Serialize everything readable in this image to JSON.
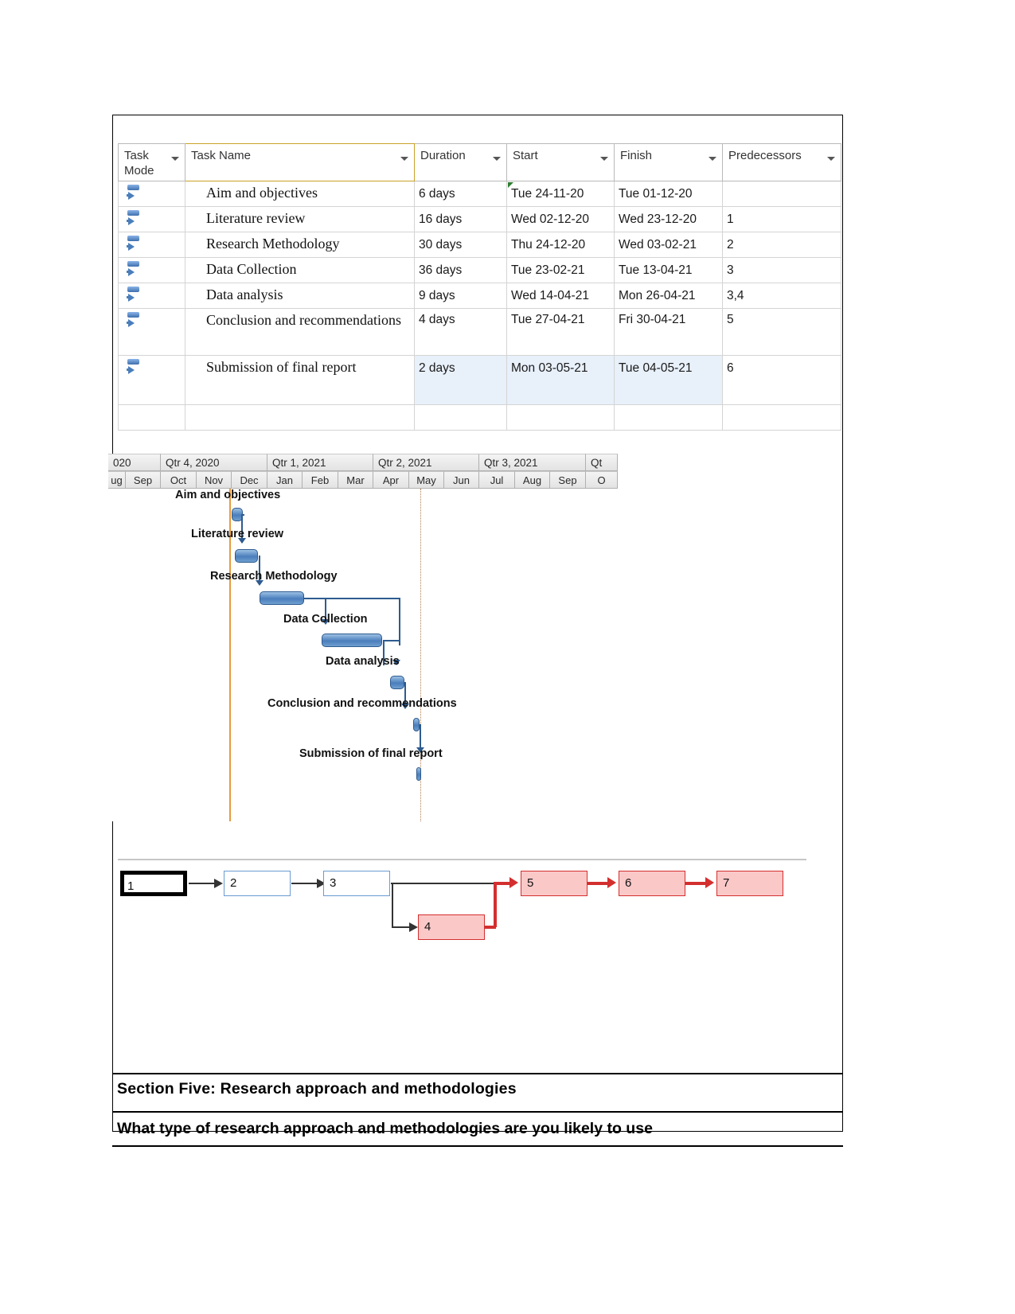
{
  "project_grid": {
    "columns": [
      {
        "label": "Task\nMode",
        "key": "mode"
      },
      {
        "label": "Task Name",
        "key": "name"
      },
      {
        "label": "Duration",
        "key": "duration"
      },
      {
        "label": "Start",
        "key": "start"
      },
      {
        "label": "Finish",
        "key": "finish"
      },
      {
        "label": "Predecessors",
        "key": "predecessors"
      }
    ],
    "rows": [
      {
        "id": 1,
        "mode_icon": "auto-schedule-icon",
        "name": "Aim and objectives",
        "duration": "6 days",
        "start": "Tue 24-11-20",
        "finish": "Tue 01-12-20",
        "predecessors": ""
      },
      {
        "id": 2,
        "mode_icon": "auto-schedule-icon",
        "name": "Literature review",
        "duration": "16 days",
        "start": "Wed 02-12-20",
        "finish": "Wed 23-12-20",
        "predecessors": "1"
      },
      {
        "id": 3,
        "mode_icon": "auto-schedule-icon",
        "name": "Research Methodology",
        "duration": "30 days",
        "start": "Thu 24-12-20",
        "finish": "Wed 03-02-21",
        "predecessors": "2"
      },
      {
        "id": 4,
        "mode_icon": "auto-schedule-icon",
        "name": "Data Collection",
        "duration": "36 days",
        "start": "Tue 23-02-21",
        "finish": "Tue 13-04-21",
        "predecessors": "3"
      },
      {
        "id": 5,
        "mode_icon": "auto-schedule-icon",
        "name": "Data analysis",
        "duration": "9 days",
        "start": "Wed 14-04-21",
        "finish": "Mon 26-04-21",
        "predecessors": "3,4"
      },
      {
        "id": 6,
        "mode_icon": "auto-schedule-icon",
        "name": "Conclusion and recommendations",
        "duration": "4 days",
        "start": "Tue 27-04-21",
        "finish": "Fri 30-04-21",
        "predecessors": "5"
      },
      {
        "id": 7,
        "mode_icon": "auto-schedule-icon",
        "name": "Submission of final report",
        "duration": "2 days",
        "start": "Mon 03-05-21",
        "finish": "Tue 04-05-21",
        "predecessors": "6"
      }
    ]
  },
  "gantt": {
    "quarters": [
      "020",
      "Qtr 4, 2020",
      "Qtr 1, 2021",
      "Qtr 2, 2021",
      "Qtr 3, 2021",
      "Qt"
    ],
    "months": [
      "ug",
      "Sep",
      "Oct",
      "Nov",
      "Dec",
      "Jan",
      "Feb",
      "Mar",
      "Apr",
      "May",
      "Jun",
      "Jul",
      "Aug",
      "Sep",
      "O"
    ],
    "bars": [
      {
        "label": "Aim and objectives",
        "duration": "6 days"
      },
      {
        "label": "Literature review",
        "duration": "16 days"
      },
      {
        "label": "Research Methodology",
        "duration": "30 days"
      },
      {
        "label": "Data Collection",
        "duration": "36 days"
      },
      {
        "label": "Data analysis",
        "duration": "9 days"
      },
      {
        "label": "Conclusion and recommendations",
        "duration": "4 days"
      },
      {
        "label": "Submission of final report",
        "duration": "2 days"
      }
    ]
  },
  "network": {
    "nodes": [
      {
        "id": "1",
        "label": "1",
        "style": "critical-start"
      },
      {
        "id": "2",
        "label": "2",
        "style": "normal"
      },
      {
        "id": "3",
        "label": "3",
        "style": "normal"
      },
      {
        "id": "4",
        "label": "4",
        "style": "critical"
      },
      {
        "id": "5",
        "label": "5",
        "style": "critical"
      },
      {
        "id": "6",
        "label": "6",
        "style": "critical"
      },
      {
        "id": "7",
        "label": "7",
        "style": "critical"
      }
    ],
    "edges": [
      {
        "from": "1",
        "to": "2"
      },
      {
        "from": "2",
        "to": "3"
      },
      {
        "from": "3",
        "to": "4"
      },
      {
        "from": "3",
        "to": "5"
      },
      {
        "from": "4",
        "to": "5"
      },
      {
        "from": "5",
        "to": "6"
      },
      {
        "from": "6",
        "to": "7"
      }
    ]
  },
  "document": {
    "section_title": "Section Five: Research approach and methodologies",
    "question": "What type of research approach and methodologies are you likely to use"
  },
  "colors": {
    "task_name_header": "#ffc000",
    "gantt_bar": "#4a7ebb",
    "critical_node": "#fbc8c8",
    "critical_border": "#d32f2f",
    "today_line": "#e59b3f"
  }
}
